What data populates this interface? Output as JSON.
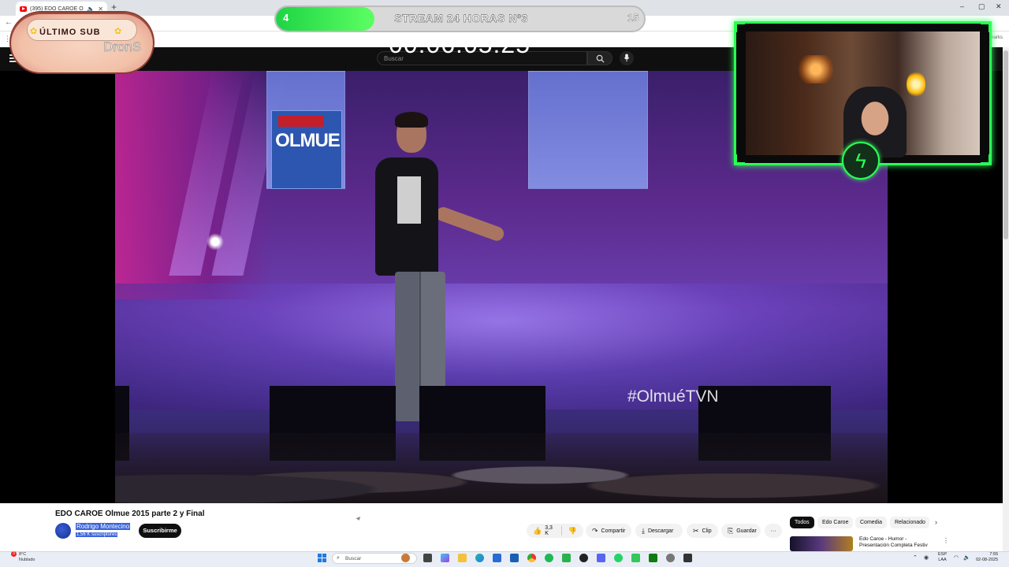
{
  "browser": {
    "tab_title": "(395) EDO CAROE Olmue 2",
    "new_tab": "+",
    "window_controls": [
      "–",
      "▢",
      "✕"
    ],
    "back": "←",
    "bookmarks_right": "marks"
  },
  "youtube_header": {
    "search_placeholder": "Buscar"
  },
  "video": {
    "hashtag": "#OlmuéTVN",
    "sign_text": "OLMUE"
  },
  "stream_overlay": {
    "sub_banner_label": "ÚLTIMO SUB",
    "sub_banner_name": "DronS",
    "progress_current": "4",
    "progress_goal": "15",
    "progress_fraction": 0.2667,
    "progress_title": "STREAM 24 HORAS Nº3",
    "timer": "00:06:05:25",
    "accent_color": "#2aff55"
  },
  "watch": {
    "title": "EDO CAROE Olmue 2015 parte 2 y Final",
    "channel_name": "Rodrigo Montecino",
    "subscribers": "1,56 K suscriptores",
    "subscribe_label": "Suscribirme",
    "like_count": "3,3 K",
    "share_label": "Compartir",
    "download_label": "Descargar",
    "clip_label": "Clip",
    "save_label": "Guardar",
    "more_label": "···"
  },
  "sidebar": {
    "chips": [
      "Todos",
      "Edo Caroe",
      "Comedia",
      "Relacionado"
    ],
    "next_arrow": "›",
    "recommended_title": "Edo Caroe - Humor - Presentación Completa Festiv",
    "recommended_more": "⋮"
  },
  "taskbar": {
    "weather_temp": "8°C",
    "weather_desc": "Nublado",
    "weather_badge": "3",
    "search_placeholder": "Buscar",
    "lang_line1": "ESP",
    "lang_line2": "LAA",
    "time": "7:55",
    "date": "02-08-2025"
  }
}
